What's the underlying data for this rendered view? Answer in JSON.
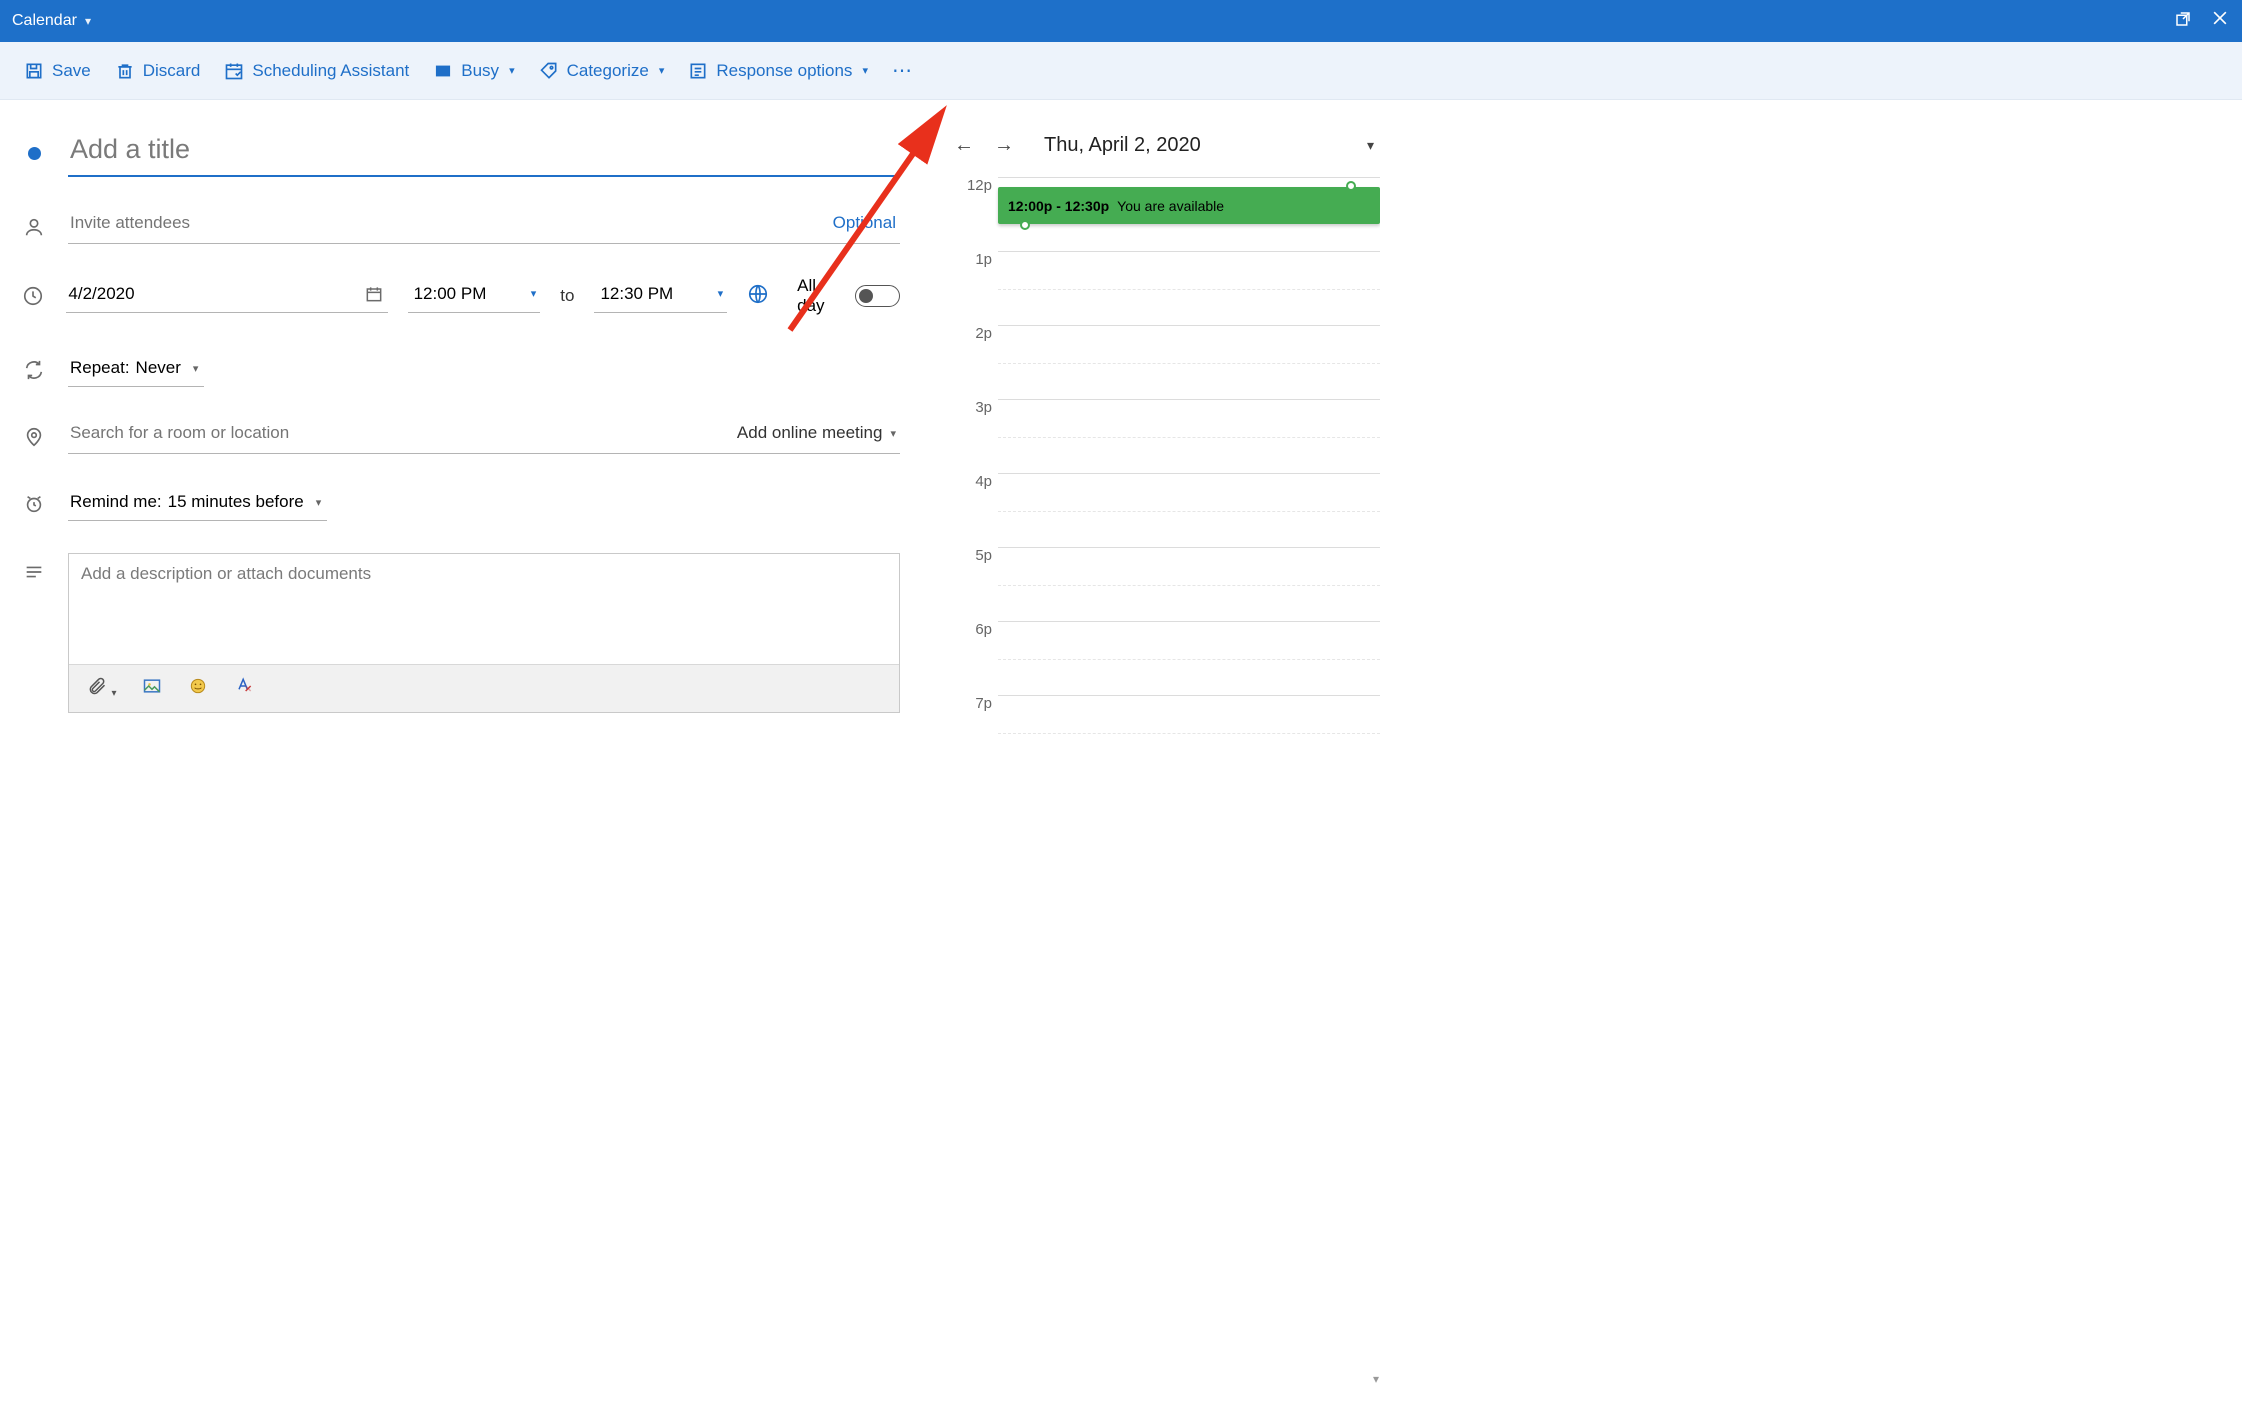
{
  "titlebar": {
    "title": "Calendar"
  },
  "toolbar": {
    "save": "Save",
    "discard": "Discard",
    "scheduling": "Scheduling Assistant",
    "busy": "Busy",
    "categorize": "Categorize",
    "response": "Response options"
  },
  "form": {
    "title_placeholder": "Add a title",
    "title_value": "",
    "attendees_placeholder": "Invite attendees",
    "attendees_value": "",
    "optional_label": "Optional",
    "date_value": "4/2/2020",
    "start_time": "12:00 PM",
    "to_label": "to",
    "end_time": "12:30 PM",
    "allday_label": "All day",
    "allday_on": false,
    "repeat_label": "Repeat:",
    "repeat_value": "Never",
    "location_placeholder": "Search for a room or location",
    "location_value": "",
    "online_meeting": "Add online meeting",
    "remind_label": "Remind me:",
    "remind_value": "15 minutes before",
    "desc_placeholder": "Add a description or attach documents",
    "desc_value": ""
  },
  "side": {
    "date": "Thu, April 2, 2020",
    "hours": [
      "12p",
      "1p",
      "2p",
      "3p",
      "4p",
      "5p",
      "6p",
      "7p"
    ],
    "event": {
      "time": "12:00p - 12:30p",
      "status": "You are available"
    }
  }
}
